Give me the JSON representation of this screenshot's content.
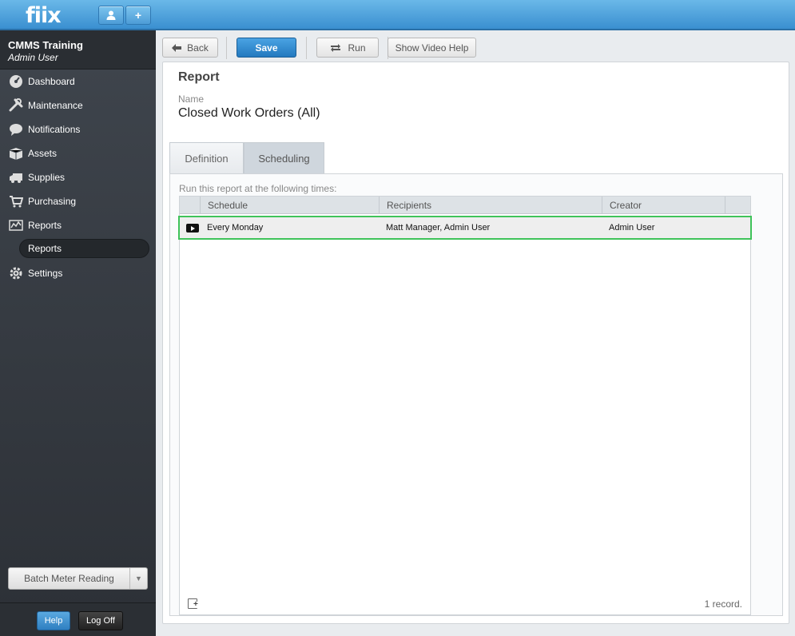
{
  "topbar": {
    "logo": "fiix",
    "user_icon": "user-icon",
    "add_icon": "plus-icon",
    "add_label": "+"
  },
  "sidebar": {
    "org_name": "CMMS Training",
    "user_name": "Admin User",
    "items": [
      {
        "label": "Dashboard",
        "icon": "dashboard-icon"
      },
      {
        "label": "Maintenance",
        "icon": "wrench-icon"
      },
      {
        "label": "Notifications",
        "icon": "speech-bubble-icon"
      },
      {
        "label": "Assets",
        "icon": "box-icon"
      },
      {
        "label": "Supplies",
        "icon": "truck-icon"
      },
      {
        "label": "Purchasing",
        "icon": "cart-icon"
      },
      {
        "label": "Reports",
        "icon": "chart-icon"
      }
    ],
    "sub_item": "Reports",
    "settings_label": "Settings",
    "batch_label": "Batch Meter Reading",
    "help_label": "Help",
    "logoff_label": "Log Off"
  },
  "toolbar": {
    "back": "Back",
    "save": "Save",
    "run": "Run",
    "video_help": "Show Video Help"
  },
  "report": {
    "section_title": "Report",
    "name_label": "Name",
    "name_value": "Closed Work Orders (All)",
    "tabs": [
      "Definition",
      "Scheduling"
    ],
    "active_tab": "Scheduling",
    "caption": "Run this report at the following times:",
    "columns": [
      "Schedule",
      "Recipients",
      "Creator"
    ],
    "rows": [
      {
        "schedule": "Every Monday",
        "recipients": "Matt Manager, Admin User",
        "creator": "Admin User"
      }
    ],
    "record_count": "1 record."
  },
  "colors": {
    "accent": "#3a8fd0",
    "highlight": "#3fc35a",
    "sidebar": "#3f454d"
  }
}
